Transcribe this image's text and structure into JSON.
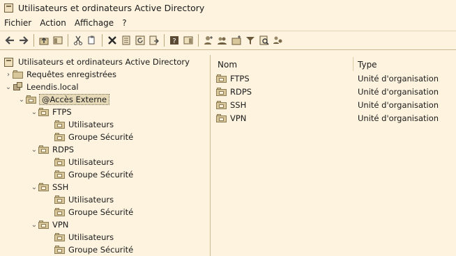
{
  "window": {
    "title": "Utilisateurs et ordinateurs Active Directory"
  },
  "menu": [
    "Fichier",
    "Action",
    "Affichage",
    "?"
  ],
  "toolbar": [
    "back-arrow-icon",
    "forward-arrow-icon",
    "up-folder-icon",
    "show-hide-console-tree-icon",
    "cut-icon",
    "copy-icon",
    "delete-icon",
    "properties-icon",
    "refresh-icon",
    "export-list-icon",
    "help-icon",
    "show-hide-action-pane-icon",
    "new-user-icon",
    "new-group-icon",
    "new-ou-icon",
    "filter-icon",
    "find-icon",
    "add-to-group-icon"
  ],
  "tree": {
    "root": "Utilisateurs et ordinateurs Active Directory",
    "saved_queries": "Requêtes enregistrées",
    "domain": "Leendis.local",
    "selected_ou": "@Accès Externe",
    "ous": [
      {
        "name": "FTPS",
        "children": [
          "Utilisateurs",
          "Groupe Sécurité"
        ]
      },
      {
        "name": "RDPS",
        "children": [
          "Utilisateurs",
          "Groupe Sécurité"
        ]
      },
      {
        "name": "SSH",
        "children": [
          "Utilisateurs",
          "Groupe Sécurité"
        ]
      },
      {
        "name": "VPN",
        "children": [
          "Utilisateurs",
          "Groupe Sécurité"
        ]
      }
    ]
  },
  "list": {
    "columns": [
      "Nom",
      "Type"
    ],
    "rows": [
      {
        "name": "FTPS",
        "type": "Unité d'organisation"
      },
      {
        "name": "RDPS",
        "type": "Unité d'organisation"
      },
      {
        "name": "SSH",
        "type": "Unité d'organisation"
      },
      {
        "name": "VPN",
        "type": "Unité d'organisation"
      }
    ]
  }
}
